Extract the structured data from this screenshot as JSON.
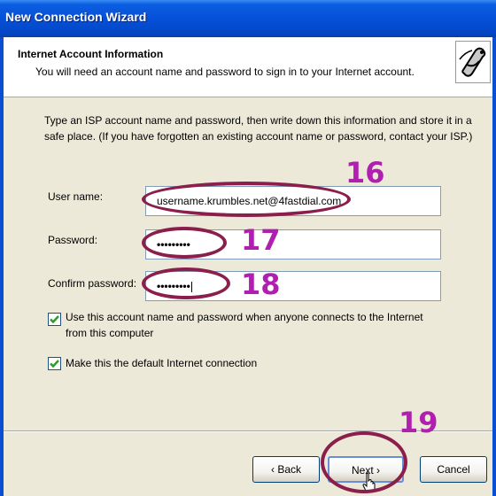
{
  "window": {
    "title": "New Connection Wizard"
  },
  "header": {
    "title": "Internet Account Information",
    "subtitle": "You will need an account name and password to sign in to your Internet account."
  },
  "intro": "Type an ISP account name and password, then write down this information and store it in a safe place. (If you have forgotten an existing account name or password, contact your ISP.)",
  "form": {
    "username_label": "User name:",
    "username_value": "username.krumbles.net@4fastdial.com",
    "password_label": "Password:",
    "password_value": "•••••••••",
    "confirm_label": "Confirm password:",
    "confirm_value": "•••••••••"
  },
  "options": {
    "use_account_label": "Use this account  name and password when anyone connects to the Internet from this computer",
    "use_account_checked": true,
    "default_connection_label": "Make this the default Internet connection",
    "default_connection_checked": true
  },
  "buttons": {
    "back": "‹ Back",
    "next": "Next ›",
    "cancel": "Cancel"
  },
  "annotations": {
    "step16": "16",
    "step17": "17",
    "step18": "18",
    "step19": "19",
    "ring_color": "#8b1e4a",
    "number_color": "#b01fb0"
  },
  "colors": {
    "titlebar": "#0550d8",
    "dialog_bg": "#ece9d8",
    "check": "#21a121"
  }
}
